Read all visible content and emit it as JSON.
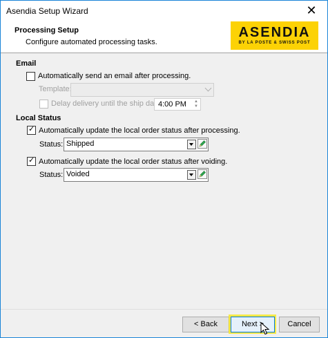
{
  "window": {
    "title": "Asendia Setup Wizard",
    "close_glyph": "✕"
  },
  "header": {
    "title": "Processing Setup",
    "subtitle": "Configure automated processing tasks.",
    "logo": {
      "main": "ASENDIA",
      "sub": "BY LA POSTE & SWISS POST",
      "bg_color": "#fcd205"
    }
  },
  "email": {
    "heading": "Email",
    "send_email": {
      "label": "Automatically send an email after processing.",
      "checked": false
    },
    "template": {
      "label": "Template:",
      "value": "",
      "enabled": false
    },
    "delay": {
      "label": "Delay delivery until the ship date at",
      "checked": false,
      "enabled": false,
      "time": "4:00 PM"
    }
  },
  "local_status": {
    "heading": "Local Status",
    "after_processing": {
      "label": "Automatically update the local order status after processing.",
      "checked": true,
      "status_label": "Status:",
      "status_value": "Shipped"
    },
    "after_voiding": {
      "label": "Automatically update the local order status after voiding.",
      "checked": true,
      "status_label": "Status:",
      "status_value": "Voided"
    }
  },
  "buttons": {
    "back": "< Back",
    "next": "Next >",
    "cancel": "Cancel"
  },
  "icons": {
    "dropdown": "dropdown-arrow-icon",
    "edit": "pencil-icon",
    "cursor": "mouse-pointer-icon"
  }
}
